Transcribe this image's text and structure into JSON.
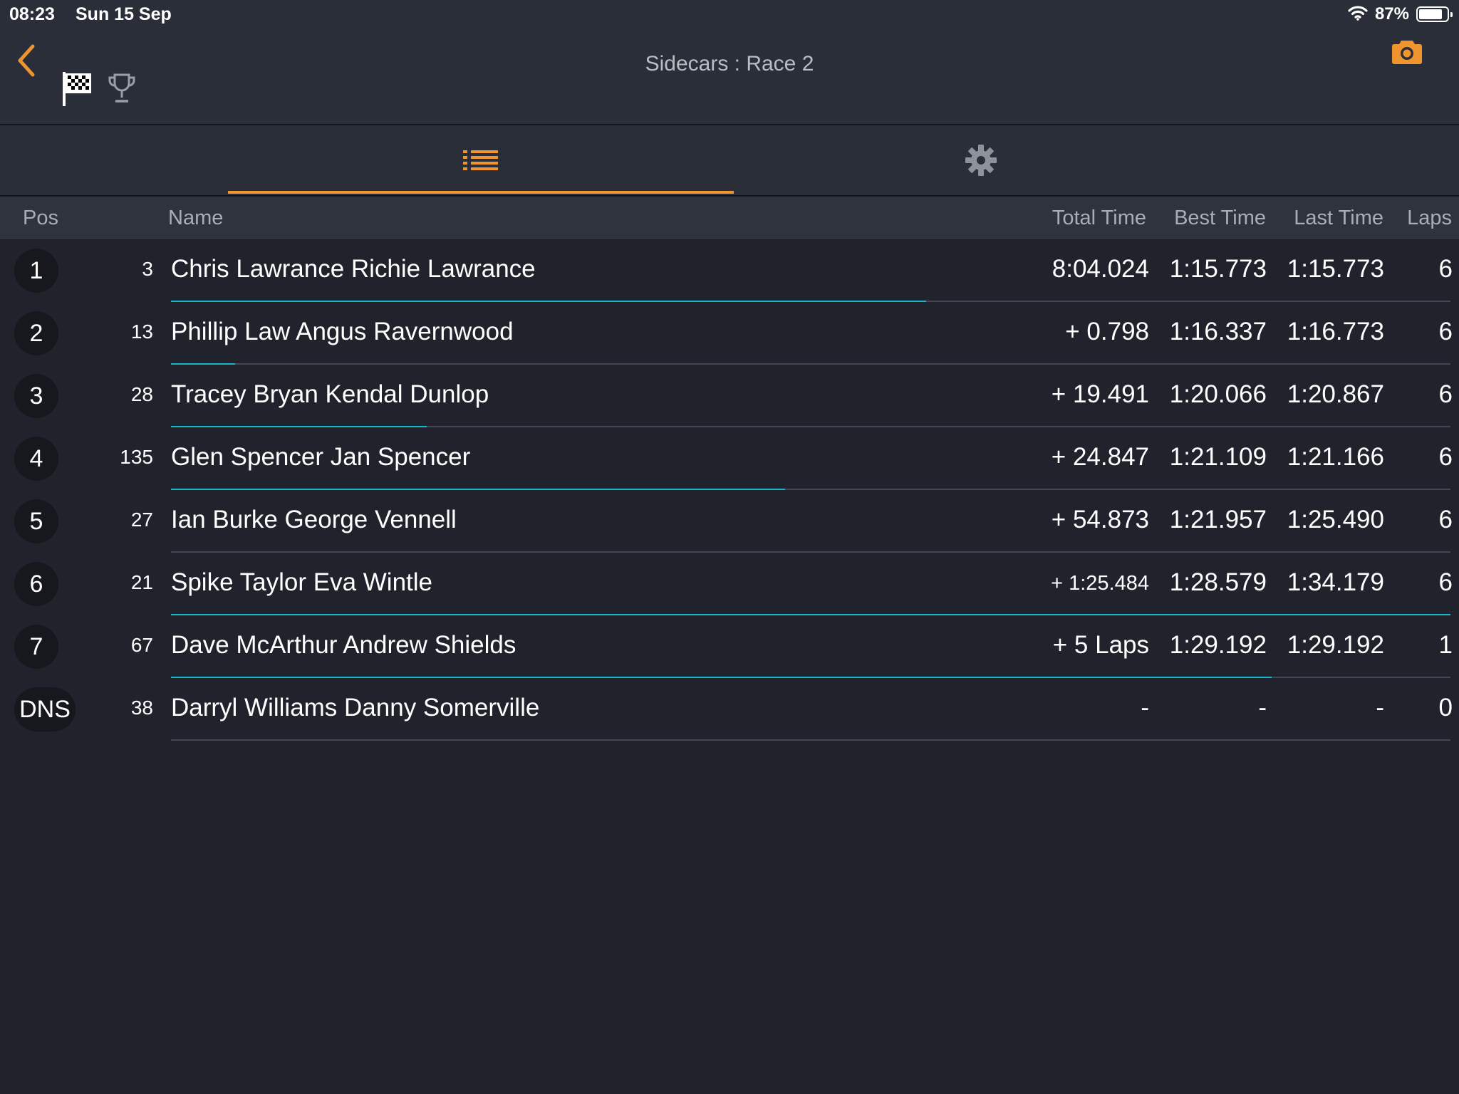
{
  "status_bar": {
    "time": "08:23",
    "date": "Sun 15 Sep",
    "battery_pct": "87%",
    "battery_level": 0.87
  },
  "nav": {
    "title": "Sidecars : Race 2"
  },
  "columns": {
    "pos": "Pos",
    "name": "Name",
    "total_time": "Total Time",
    "best_time": "Best Time",
    "last_time": "Last Time",
    "laps": "Laps"
  },
  "colors": {
    "accent": "#f0942e",
    "progress": "#1fb3c9",
    "background": "#20232c",
    "panel": "#2a2e38"
  },
  "rows": [
    {
      "pos": "1",
      "number": "3",
      "name": "Chris Lawrance Richie Lawrance",
      "total_time": "8:04.024",
      "best_time": "1:15.773",
      "last_time": "1:15.773",
      "laps": "6",
      "progress": 0.59
    },
    {
      "pos": "2",
      "number": "13",
      "name": "Phillip Law Angus Ravernwood",
      "total_time": "+ 0.798",
      "best_time": "1:16.337",
      "last_time": "1:16.773",
      "laps": "6",
      "progress": 0.05
    },
    {
      "pos": "3",
      "number": "28",
      "name": "Tracey Bryan Kendal Dunlop",
      "total_time": "+ 19.491",
      "best_time": "1:20.066",
      "last_time": "1:20.867",
      "laps": "6",
      "progress": 0.2
    },
    {
      "pos": "4",
      "number": "135",
      "name": "Glen Spencer Jan Spencer",
      "total_time": "+ 24.847",
      "best_time": "1:21.109",
      "last_time": "1:21.166",
      "laps": "6",
      "progress": 0.48
    },
    {
      "pos": "5",
      "number": "27",
      "name": "Ian Burke George Vennell",
      "total_time": "+ 54.873",
      "best_time": "1:21.957",
      "last_time": "1:25.490",
      "laps": "6",
      "progress": 0
    },
    {
      "pos": "6",
      "number": "21",
      "name": "Spike Taylor Eva Wintle",
      "total_time": "+ 1:25.484",
      "best_time": "1:28.579",
      "last_time": "1:34.179",
      "laps": "6",
      "progress": 1
    },
    {
      "pos": "7",
      "number": "67",
      "name": "Dave McArthur Andrew Shields",
      "total_time": "+ 5 Laps",
      "best_time": "1:29.192",
      "last_time": "1:29.192",
      "laps": "1",
      "progress": 0.86
    },
    {
      "pos": "DNS",
      "number": "38",
      "name": "Darryl Williams Danny Somerville",
      "total_time": "-",
      "best_time": "-",
      "last_time": "-",
      "laps": "0",
      "progress": 0
    }
  ]
}
